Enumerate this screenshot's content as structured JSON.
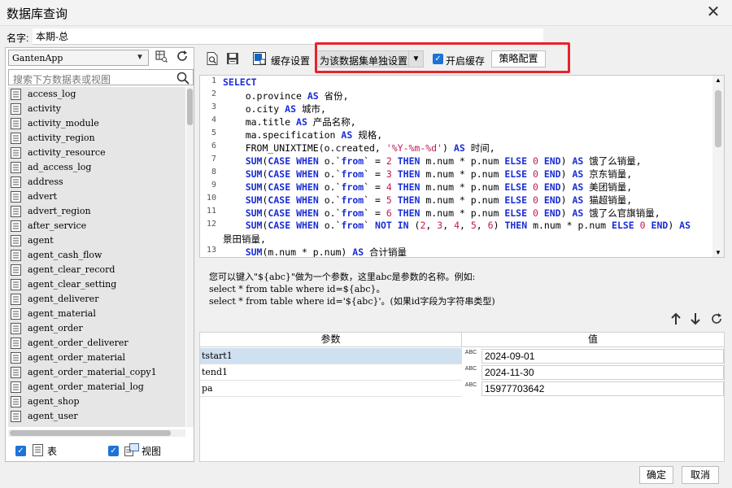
{
  "window": {
    "title": "数据库查询"
  },
  "name_field": {
    "label": "名字:",
    "value": "本期-总"
  },
  "left_panel": {
    "db_select": "GantenApp",
    "search_placeholder": "搜索下方数据表或视图",
    "tables": [
      "access_log",
      "activity",
      "activity_module",
      "activity_region",
      "activity_resource",
      "ad_access_log",
      "address",
      "advert",
      "advert_region",
      "after_service",
      "agent",
      "agent_cash_flow",
      "agent_clear_record",
      "agent_clear_setting",
      "agent_deliverer",
      "agent_material",
      "agent_order",
      "agent_order_deliverer",
      "agent_order_material",
      "agent_order_material_copy1",
      "agent_order_material_log",
      "agent_shop",
      "agent_user"
    ],
    "filter_table_label": "表",
    "filter_view_label": "视图"
  },
  "toolbar": {
    "cache_settings": "缓存设置",
    "dataset_select": "为该数据集单独设置",
    "enable_cache": "开启缓存",
    "strategy_config": "策略配置"
  },
  "sql_lines": [
    {
      "n": "1",
      "t": "SELECT"
    },
    {
      "n": "2",
      "t": "    o.province AS 省份,"
    },
    {
      "n": "3",
      "t": "    o.city AS 城市,"
    },
    {
      "n": "4",
      "t": "    ma.title AS 产品名称,"
    },
    {
      "n": "5",
      "t": "    ma.specification AS 规格,"
    },
    {
      "n": "6",
      "t": "    FROM_UNIXTIME(o.created, '%Y-%m-%d') AS 时间,"
    },
    {
      "n": "7",
      "t": "    SUM(CASE WHEN o.`from` = 2 THEN m.num * p.num ELSE 0 END) AS 饿了么销量,"
    },
    {
      "n": "8",
      "t": "    SUM(CASE WHEN o.`from` = 3 THEN m.num * p.num ELSE 0 END) AS 京东销量,"
    },
    {
      "n": "9",
      "t": "    SUM(CASE WHEN o.`from` = 4 THEN m.num * p.num ELSE 0 END) AS 美团销量,"
    },
    {
      "n": "10",
      "t": "    SUM(CASE WHEN o.`from` = 5 THEN m.num * p.num ELSE 0 END) AS 猫超销量,"
    },
    {
      "n": "11",
      "t": "    SUM(CASE WHEN o.`from` = 6 THEN m.num * p.num ELSE 0 END) AS 饿了么官旗销量,"
    },
    {
      "n": "12",
      "t": "    SUM(CASE WHEN o.`from` NOT IN (2, 3, 4, 5, 6) THEN m.num * p.num ELSE 0 END) AS"
    },
    {
      "n": "",
      "t": "景田销量,"
    },
    {
      "n": "13",
      "t": "    SUM(m.num * p.num) AS 合计销量"
    }
  ],
  "help": {
    "line1": "您可以键入\"${abc}\"做为一个参数，这里abc是参数的名称。例如:",
    "line2": "select * from table where id=${abc}。",
    "line3": "select * from table where id='${abc}'。(如果id字段为字符串类型)"
  },
  "params": {
    "header_name": "参数",
    "header_value": "值",
    "rows": [
      {
        "name": "tstart1",
        "value": "2024-09-01"
      },
      {
        "name": "tend1",
        "value": "2024-11-30"
      },
      {
        "name": "pa",
        "value": "15977703642"
      }
    ],
    "type_label": "ABC"
  },
  "buttons": {
    "ok": "确定",
    "cancel": "取消"
  }
}
